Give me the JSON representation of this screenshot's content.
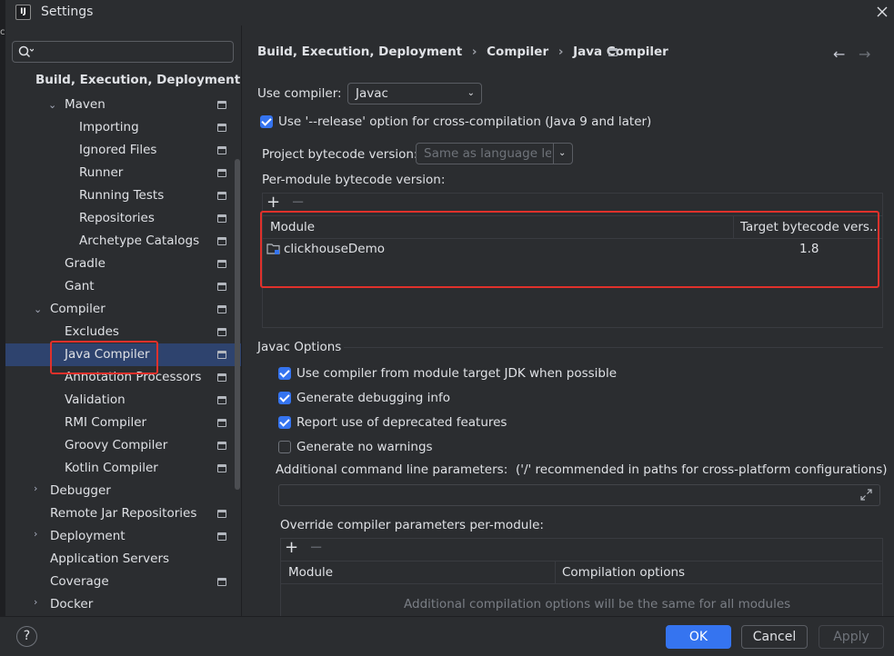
{
  "window": {
    "title": "Settings",
    "logo_text": "IJ"
  },
  "left_strip": {
    "mark": "c"
  },
  "search": {
    "placeholder": ""
  },
  "tree": {
    "section": "Build, Execution, Deployment",
    "items": [
      {
        "label": "Maven",
        "expanded": true
      },
      {
        "label": "Importing"
      },
      {
        "label": "Ignored Files"
      },
      {
        "label": "Runner"
      },
      {
        "label": "Running Tests"
      },
      {
        "label": "Repositories"
      },
      {
        "label": "Archetype Catalogs"
      },
      {
        "label": "Gradle"
      },
      {
        "label": "Gant"
      },
      {
        "label": "Compiler",
        "expanded": true
      },
      {
        "label": "Excludes"
      },
      {
        "label": "Java Compiler",
        "selected": true
      },
      {
        "label": "Annotation Processors"
      },
      {
        "label": "Validation"
      },
      {
        "label": "RMI Compiler"
      },
      {
        "label": "Groovy Compiler"
      },
      {
        "label": "Kotlin Compiler"
      },
      {
        "label": "Debugger",
        "collapsed": true
      },
      {
        "label": "Remote Jar Repositories"
      },
      {
        "label": "Deployment",
        "collapsed": true
      },
      {
        "label": "Application Servers"
      },
      {
        "label": "Coverage"
      },
      {
        "label": "Docker",
        "collapsed": true
      }
    ]
  },
  "breadcrumb": {
    "part1": "Build, Execution, Deployment",
    "sep": "›",
    "part2": "Compiler",
    "part3": "Java Compiler"
  },
  "nav": {
    "back": "←",
    "forward": "→"
  },
  "compiler": {
    "use_compiler_label": "Use compiler:",
    "use_compiler_value": "Javac",
    "release_option_label": "Use '--release' option for cross-compilation (Java 9 and later)",
    "release_option_checked": true,
    "project_bytecode_label": "Project bytecode version:",
    "project_bytecode_value": "Same as language level",
    "per_module_label": "Per-module bytecode version:",
    "per_module_table": {
      "add": "+",
      "remove": "−",
      "col_module": "Module",
      "col_target": "Target bytecode vers...",
      "rows": [
        {
          "module": "clickhouseDemo",
          "target": "1.8"
        }
      ]
    }
  },
  "javac": {
    "section_title": "Javac Options",
    "options": [
      {
        "label": "Use compiler from module target JDK when possible",
        "checked": true
      },
      {
        "label": "Generate debugging info",
        "checked": true
      },
      {
        "label": "Report use of deprecated features",
        "checked": true
      },
      {
        "label": "Generate no warnings",
        "checked": false
      }
    ],
    "cmdline_label": "Additional command line parameters:",
    "cmdline_hint": "('/' recommended in paths for cross-platform configurations)",
    "cmdline_value": "",
    "override_label": "Override compiler parameters per-module:",
    "override_table": {
      "add": "+",
      "remove": "−",
      "col_module": "Module",
      "col_options": "Compilation options",
      "empty_text": "Additional compilation options will be the same for all modules"
    }
  },
  "footer": {
    "help": "?",
    "ok": "OK",
    "cancel": "Cancel",
    "apply": "Apply"
  },
  "colors": {
    "accent": "#3574f0",
    "annotation": "#e0312b",
    "selection": "#2e436e"
  }
}
